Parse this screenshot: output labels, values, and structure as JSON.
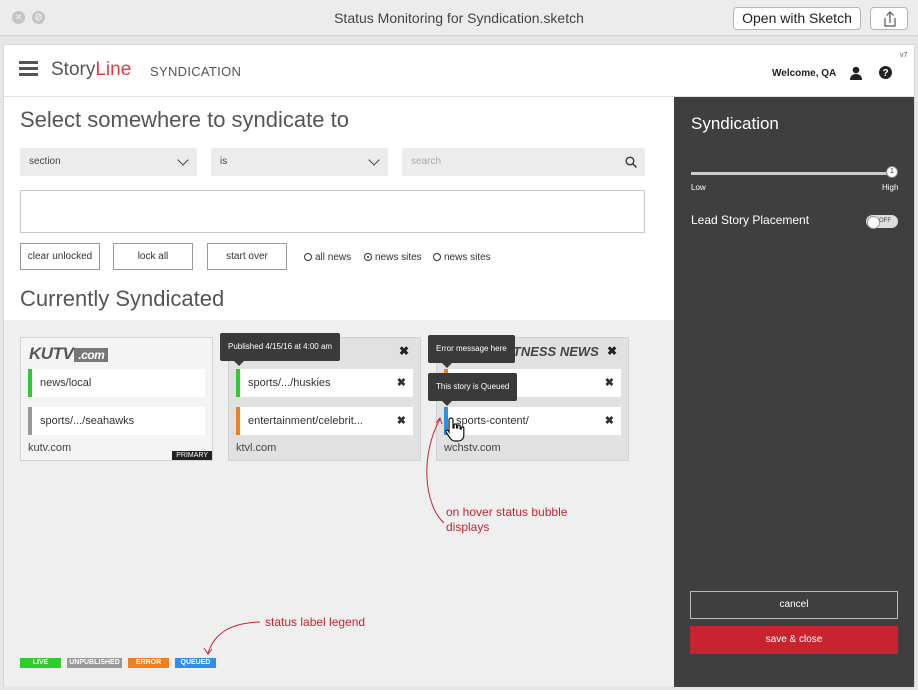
{
  "window": {
    "title": "Status Monitoring for Syndication.sketch",
    "open_label": "Open with Sketch"
  },
  "header": {
    "logo_story": "Story",
    "logo_line": "Line",
    "section": "SYNDICATION",
    "welcome": "Welcome, QA",
    "version": "v7"
  },
  "main": {
    "heading": "Select somewhere to syndicate to",
    "filter1": "section",
    "filter2": "is",
    "search_placeholder": "search",
    "buttons": [
      "clear unlocked",
      "lock all",
      "start over"
    ],
    "radios": [
      {
        "label": "all news",
        "selected": false
      },
      {
        "label": "news sites",
        "selected": true
      },
      {
        "label": "news sites",
        "selected": false
      }
    ],
    "subheading": "Currently Syndicated"
  },
  "cards": [
    {
      "logo": "KUTV",
      "logo_suffix": ".com",
      "domain": "kutv.com",
      "badge": "PRIMARY",
      "rows": [
        {
          "text": "news/local",
          "status": "live"
        },
        {
          "text": "sports/.../seahawks",
          "status": "unpublished"
        }
      ]
    },
    {
      "domain": "ktvl.com",
      "rows": [
        {
          "text": "sports/.../huskies",
          "status": "live"
        },
        {
          "text": "entertainment/celebrit...",
          "status": "error"
        }
      ]
    },
    {
      "logo": "WITNESS NEWS",
      "domain": "wchstv.com",
      "rows": [
        {
          "text": "",
          "status": "error"
        },
        {
          "text": "sports-content/",
          "status": "queued"
        }
      ]
    }
  ],
  "tooltips": {
    "published": "Published 4/15/16 at 4:00 am",
    "error": "Error message here",
    "queued": "This story is Queued"
  },
  "annotations": {
    "hover_line1": "on hover status bubble",
    "hover_line2": "displays",
    "legend_note": "status label legend"
  },
  "legend": [
    {
      "label": "LIVE",
      "color": "#2ecc2e"
    },
    {
      "label": "UNPUBLISHED",
      "color": "#999999"
    },
    {
      "label": "ERROR",
      "color": "#f07f1c"
    },
    {
      "label": "QUEUED",
      "color": "#2f8fe6"
    }
  ],
  "panel": {
    "title": "Syndication",
    "slider_value": "1",
    "low": "Low",
    "high": "High",
    "lead_story": "Lead Story Placement",
    "toggle": "OFF",
    "cancel": "cancel",
    "save": "save & close"
  }
}
